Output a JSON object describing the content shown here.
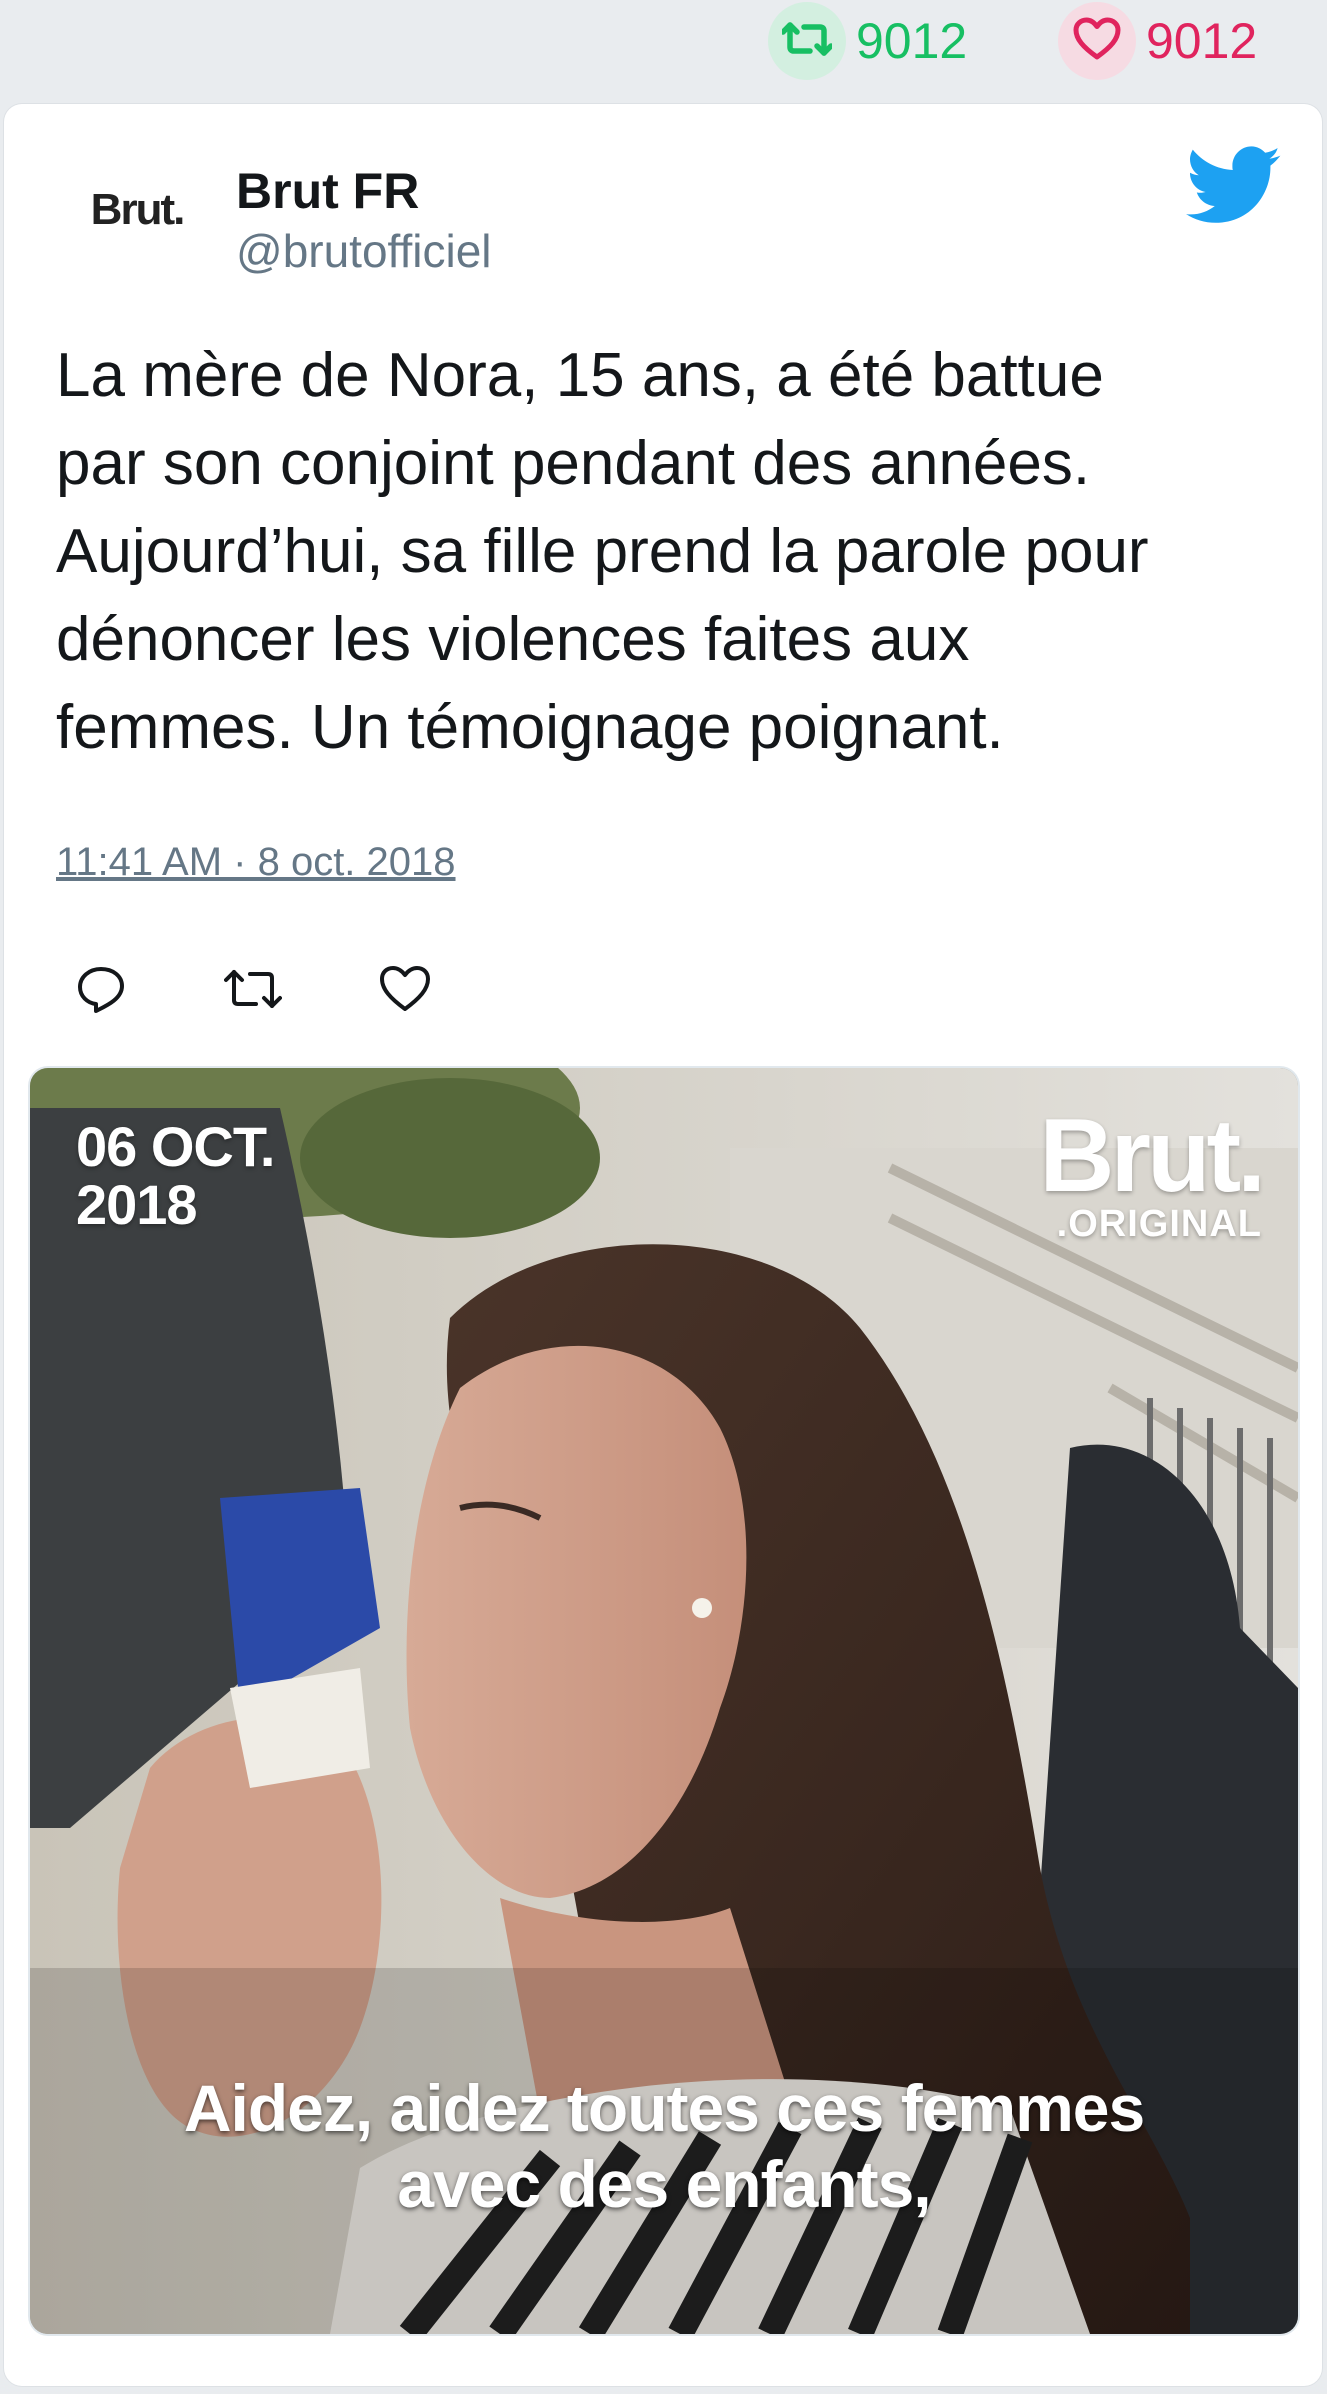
{
  "stats": {
    "retweets_count": "9012",
    "likes_count": "9012",
    "retweet_color": "#17bf63",
    "like_color": "#e0245e"
  },
  "tweet": {
    "avatar_text": "Brut.",
    "author_name": "Brut FR",
    "author_handle": "@brutofficiel",
    "text": "La mère de Nora, 15 ans, a été battue\npar son conjoint pendant des années.\nAujourd’hui, sa fille prend la parole pour\ndénoncer les violences faites aux\nfemmes. Un témoignage poignant.",
    "timestamp": "11:41 AM · 8 oct. 2018",
    "brand_color": "#1da1f2",
    "icons": [
      "twitter-bird-icon",
      "reply-icon",
      "retweet-icon",
      "like-icon"
    ]
  },
  "media": {
    "date_overlay": "06 OCT.\n2018",
    "brand_overlay": "Brut.",
    "brand_sub": ".ORIGINAL",
    "subtitle": "Aidez, aidez toutes ces femmes\navec des enfants,"
  }
}
